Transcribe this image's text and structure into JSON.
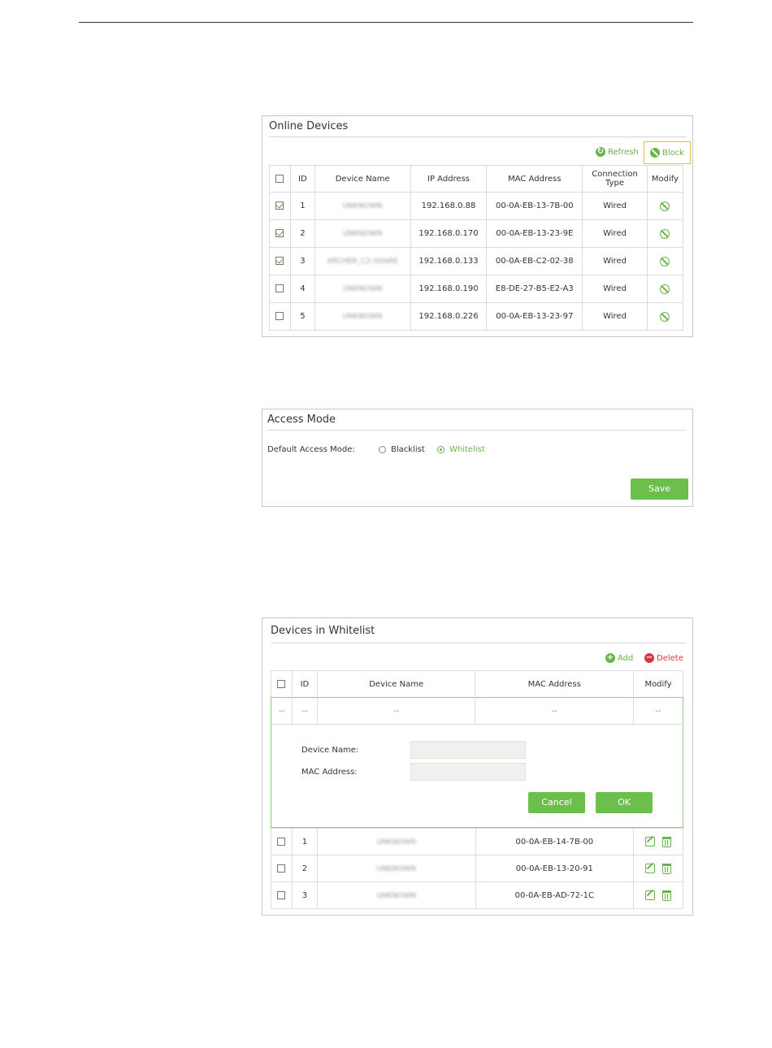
{
  "online_devices": {
    "title": "Online Devices",
    "refresh_label": "Refresh",
    "block_label": "Block",
    "columns": [
      "ID",
      "Device Name",
      "IP Address",
      "MAC Address",
      "Connection Type",
      "Modify"
    ],
    "rows": [
      {
        "checked": true,
        "id": "1",
        "name": "UNKNOWN",
        "ip": "192.168.0.88",
        "mac": "00-0A-EB-13-7B-00",
        "type": "Wired"
      },
      {
        "checked": true,
        "id": "2",
        "name": "UNKNOWN",
        "ip": "192.168.0.170",
        "mac": "00-0A-EB-13-23-9E",
        "type": "Wired"
      },
      {
        "checked": true,
        "id": "3",
        "name": "ARCHER_C2-SHARE",
        "ip": "192.168.0.133",
        "mac": "00-0A-EB-C2-02-38",
        "type": "Wired"
      },
      {
        "checked": false,
        "id": "4",
        "name": "UNKNOWN",
        "ip": "192.168.0.190",
        "mac": "E8-DE-27-B5-E2-A3",
        "type": "Wired"
      },
      {
        "checked": false,
        "id": "5",
        "name": "UNKNOWN",
        "ip": "192.168.0.226",
        "mac": "00-0A-EB-13-23-97",
        "type": "Wired"
      }
    ]
  },
  "access_mode": {
    "title": "Access Mode",
    "label": "Default Access Mode:",
    "blacklist_label": "Blacklist",
    "whitelist_label": "Whitelist",
    "selected": "Whitelist",
    "save_label": "Save"
  },
  "whitelist": {
    "title": "Devices in Whitelist",
    "add_label": "Add",
    "delete_label": "Delete",
    "columns": [
      "ID",
      "Device Name",
      "MAC Address",
      "Modify"
    ],
    "placeholder_row": [
      "--",
      "--",
      "--",
      "--",
      "--"
    ],
    "form": {
      "device_name_label": "Device Name:",
      "mac_label": "MAC Address:",
      "device_name_value": "",
      "mac_value": "",
      "cancel_label": "Cancel",
      "ok_label": "OK"
    },
    "rows": [
      {
        "id": "1",
        "name": "UNKNOWN",
        "mac": "00-0A-EB-14-7B-00"
      },
      {
        "id": "2",
        "name": "UNKNOWN",
        "mac": "00-0A-EB-13-20-91"
      },
      {
        "id": "3",
        "name": "UNKNOWN",
        "mac": "00-0A-EB-AD-72-1C"
      }
    ]
  },
  "colors": {
    "accent": "#6ab549",
    "delete": "#d9363e",
    "highlight": "#e8b84a"
  }
}
